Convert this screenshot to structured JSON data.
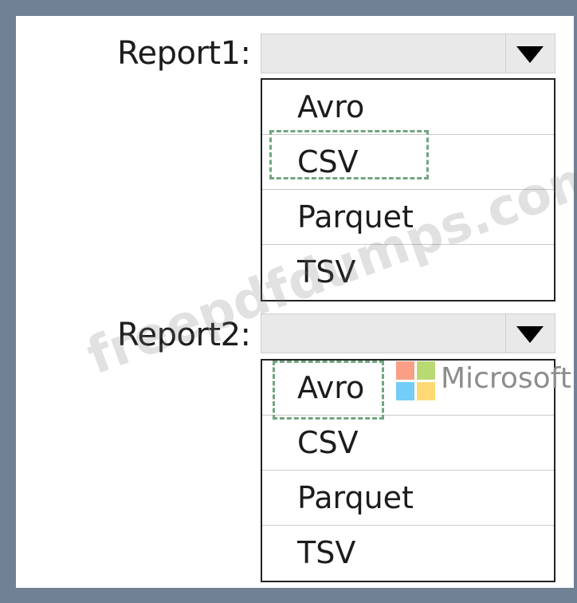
{
  "report1": {
    "label": "Report1:",
    "selected_value": "",
    "options": [
      "Avro",
      "CSV",
      "Parquet",
      "TSV"
    ]
  },
  "report2": {
    "label": "Report2:",
    "selected_value": "",
    "options": [
      "Avro",
      "CSV",
      "Parquet",
      "TSV"
    ]
  },
  "watermark": {
    "text": "freepdfdumps.com"
  },
  "logo": {
    "text": "Microsoft"
  },
  "colors": {
    "frame": "#6f8193",
    "answer_highlight": "#71a67f",
    "logo_red": "#f25022",
    "logo_green": "#7fba00",
    "logo_blue": "#00a4ef",
    "logo_yellow": "#ffb900"
  }
}
